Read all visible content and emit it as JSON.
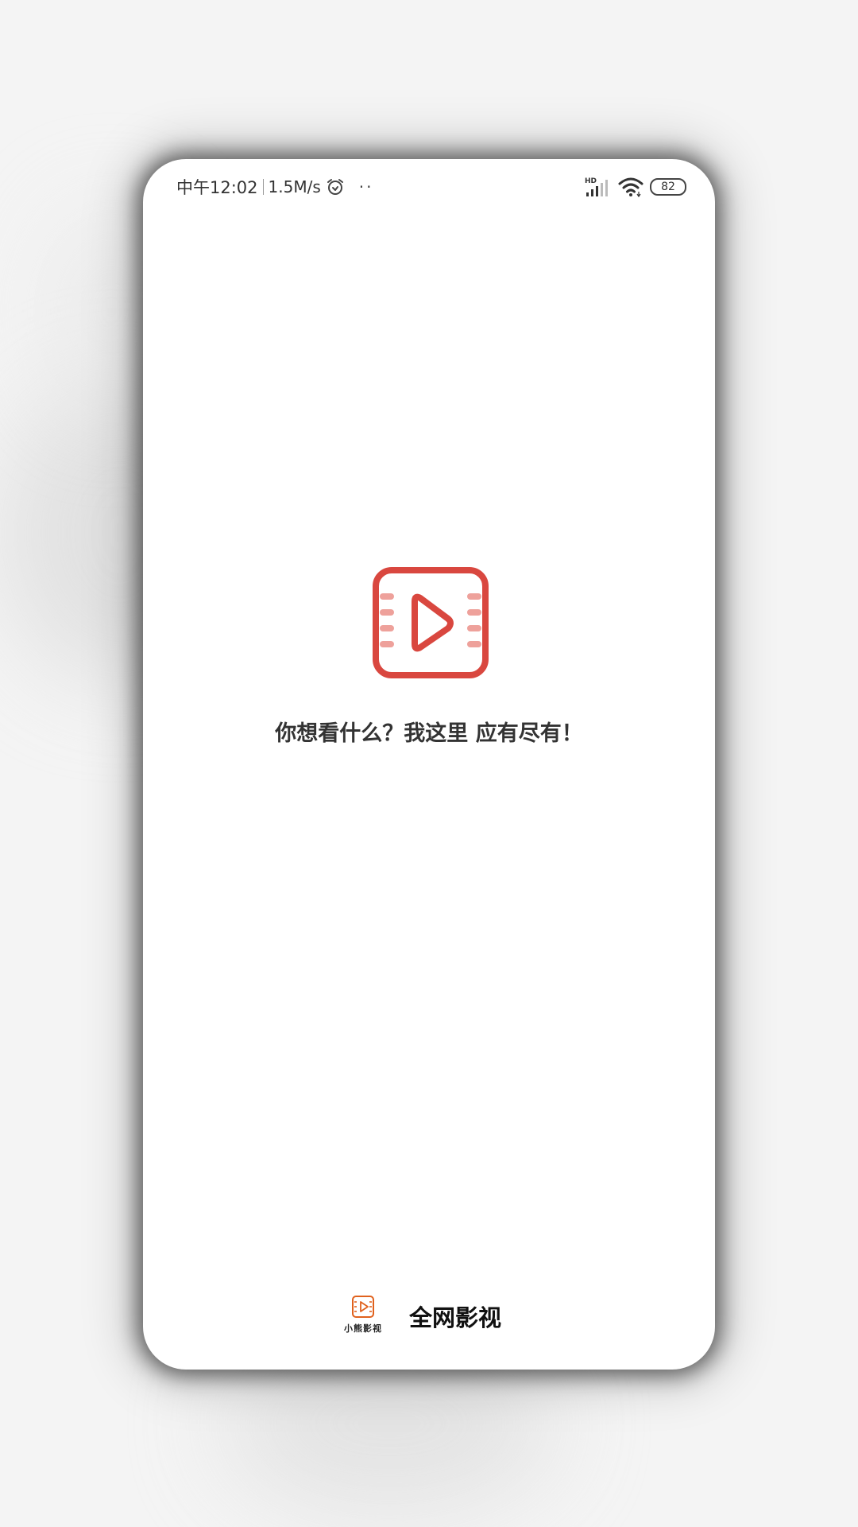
{
  "status_bar": {
    "time": "中午12:02",
    "net_speed": "1.5M/s",
    "dots": "··",
    "signal_label": "HD",
    "battery": "82"
  },
  "splash": {
    "tagline": "你想看什么？我这里 应有尽有！",
    "icon": "video-play-icon",
    "accent_color": "#d9473f",
    "accent_light": "#eea19b"
  },
  "brand": {
    "logo_caption": "小熊影视",
    "name": "全网影视",
    "logo_color": "#e0611d"
  }
}
